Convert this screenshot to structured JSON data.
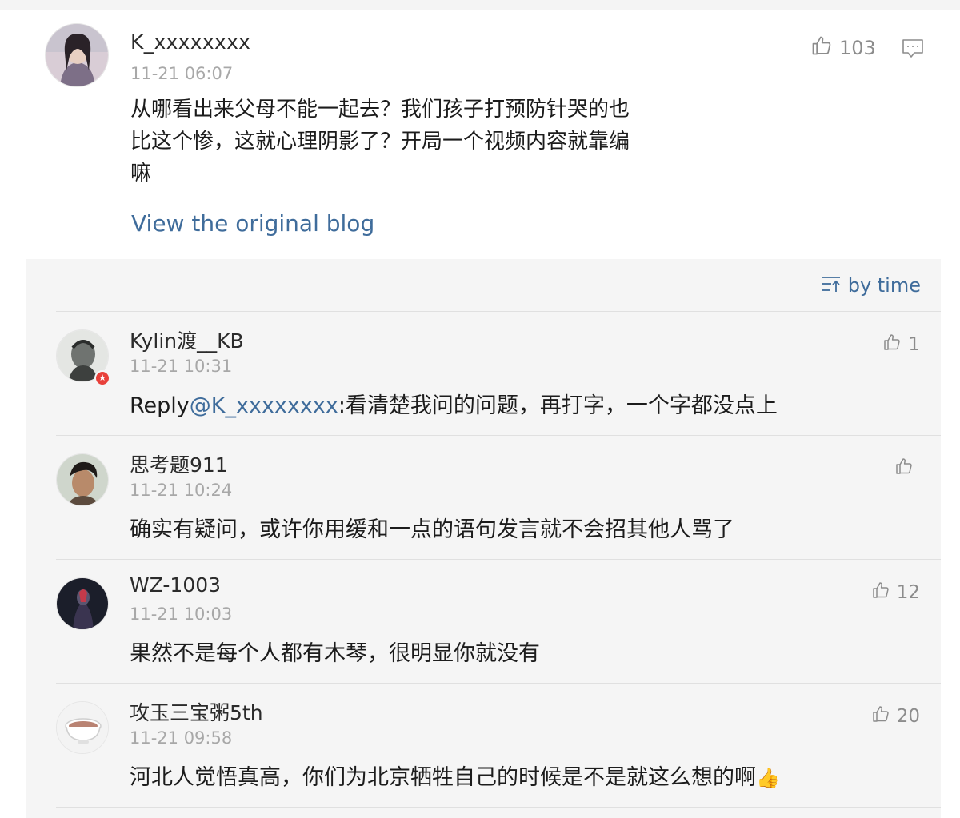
{
  "main_comment": {
    "username": "K_xxxxxxxx",
    "time": "11-21 06:07",
    "line1": "从哪看出来父母不能一起去？我们孩子打预防针哭的也",
    "line2": "比这个惨，这就心理阴影了？开局一个视频内容就靠编",
    "line3": "嘛",
    "like_count": "103",
    "view_original": "View the original blog"
  },
  "sort": {
    "label": "by time"
  },
  "replies": [
    {
      "username": "Kylin渡__KB",
      "time": "11-21 10:31",
      "prefix": "Reply",
      "mention": "@K_xxxxxxxx",
      "text": ":看清楚我问的问题，再打字，一个字都没点上",
      "likes": "1"
    },
    {
      "username": "思考题911",
      "time": "11-21 10:24",
      "text": "确实有疑问，或许你用缓和一点的语句发言就不会招其他人骂了",
      "likes": ""
    },
    {
      "username": "WZ-1003",
      "time": "11-21 10:03",
      "text": "果然不是每个人都有木琴，很明显你就没有",
      "likes": "12"
    },
    {
      "username": "攻玉三宝粥5th",
      "time": "11-21 09:58",
      "text": "河北人觉悟真高，你们为北京牺牲自己的时候是不是就这么想的啊",
      "emoji": "👍",
      "likes": "20"
    }
  ],
  "colors": {
    "link": "#3f6c9b",
    "panel_bg": "#f5f5f5",
    "muted": "#a8a8a8"
  },
  "icons": [
    "thumbs-up-icon",
    "comment-icon",
    "sort-icon",
    "verified-badge-icon"
  ]
}
